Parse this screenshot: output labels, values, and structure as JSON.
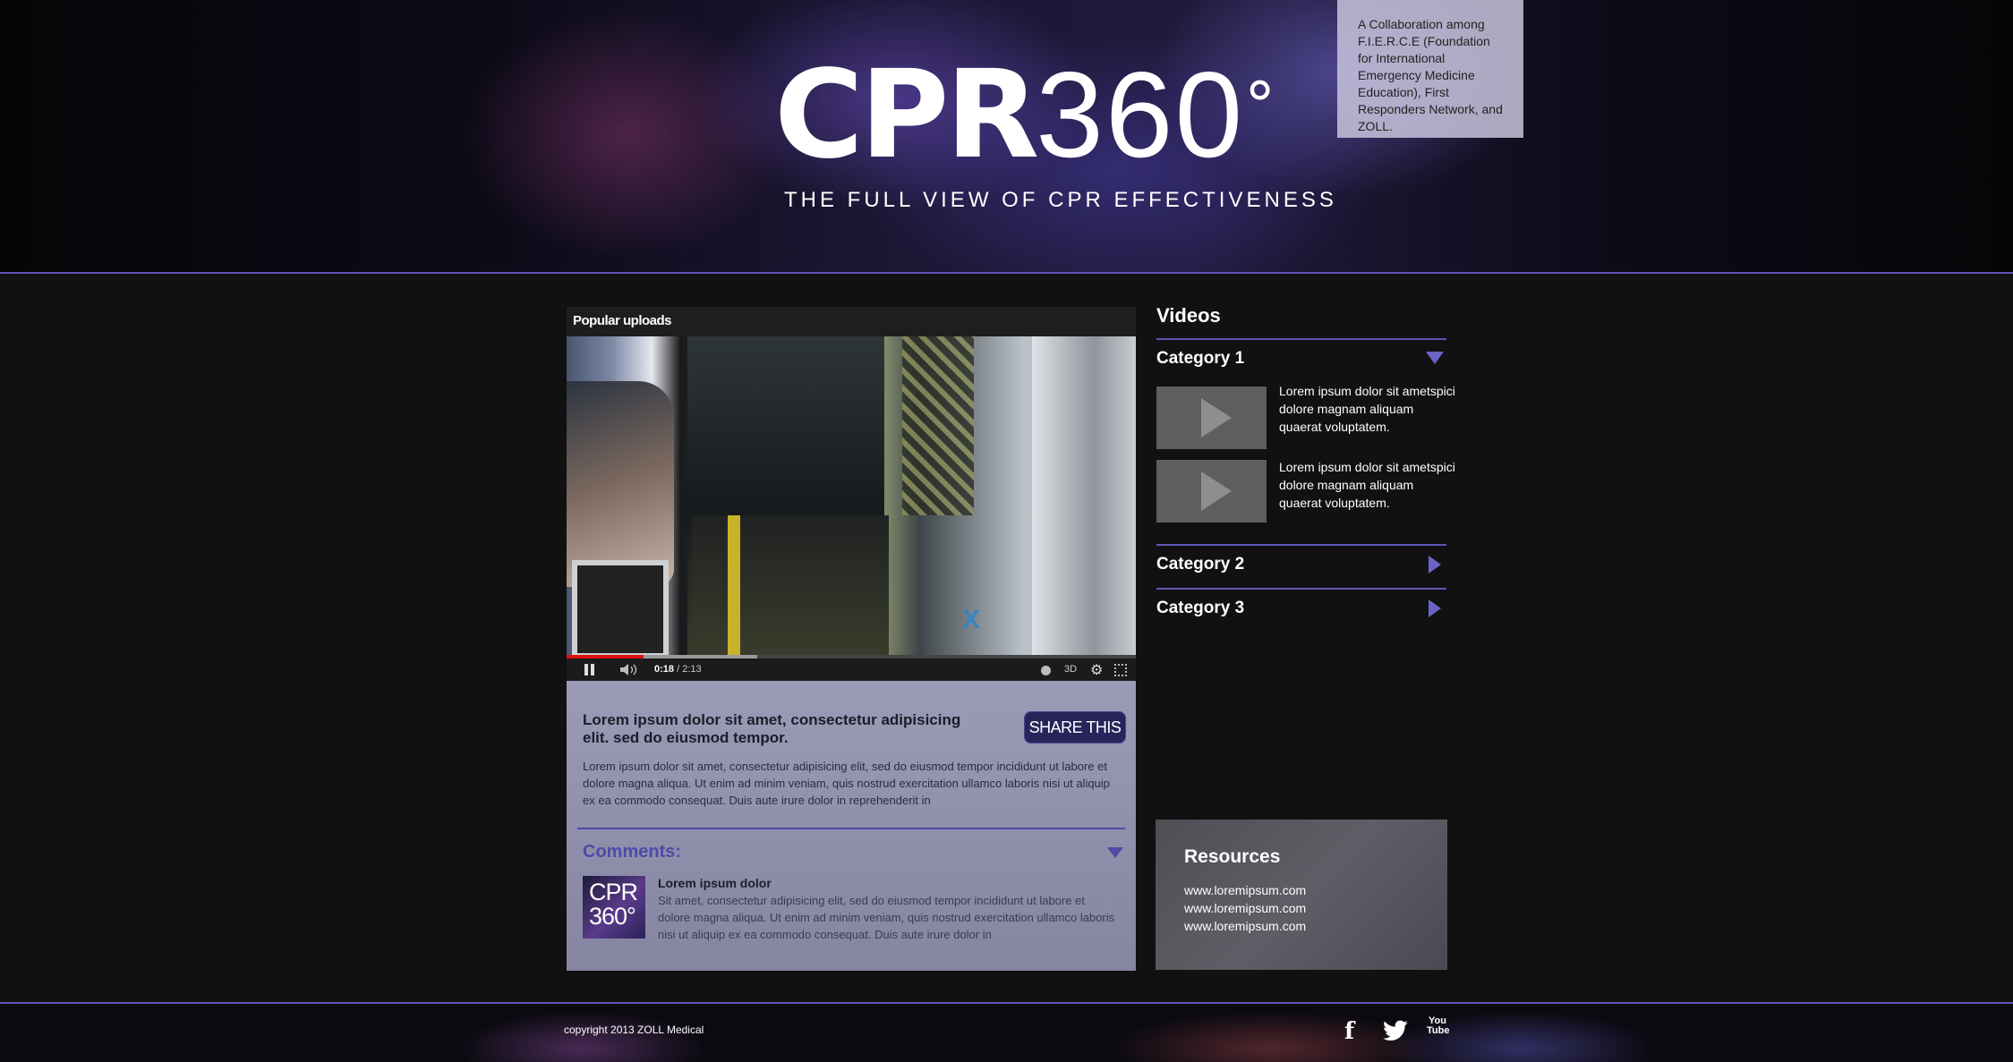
{
  "header": {
    "logo_bold": "CPR",
    "logo_light": "360",
    "logo_degree": "°",
    "tagline": "THE FULL VIEW OF CPR EFFECTIVENESS",
    "collaboration": "A Collaboration among F.I.E.R.C.E (Foundation for International Emergency Medicine Education), First Responders Network, and ZOLL."
  },
  "video_panel": {
    "heading": "Popular uploads",
    "player": {
      "current_time": "0:18",
      "duration": "2:13",
      "time_separator": " / ",
      "mode_label": "3D",
      "watermark": "X",
      "progress_played": 0.135
    },
    "title": "Lorem ipsum dolor sit amet, consectetur adipisicing elit. sed do eiusmod tempor.",
    "share_label": "SHARE THIS",
    "body": "Lorem ipsum dolor sit amet, consectetur adipisicing elit, sed do eiusmod tempor incididunt ut labore et dolore magna aliqua. Ut enim ad minim veniam, quis nostrud exercitation ullamco laboris nisi ut aliquip ex ea commodo consequat. Duis aute irure dolor in reprehenderit in",
    "comments_label": "Comments:",
    "comment": {
      "avatar_line1": "CPR",
      "avatar_line2": "360°",
      "author": "Lorem ipsum dolor",
      "text": "Sit amet, consectetur adipisicing elit, sed do eiusmod tempor incididunt ut labore et dolore magna aliqua. Ut enim ad minim veniam, quis nostrud exercitation ullamco laboris nisi ut aliquip ex ea commodo consequat. Duis aute irure dolor in"
    }
  },
  "sidebar": {
    "title": "Videos",
    "categories": [
      {
        "label": "Category 1",
        "expanded": true
      },
      {
        "label": "Category 2",
        "expanded": false
      },
      {
        "label": "Category 3",
        "expanded": false
      }
    ],
    "videos": [
      {
        "text": "Lorem ipsum dolor sit ametspici dolore magnam aliquam quaerat voluptatem."
      },
      {
        "text": "Lorem ipsum dolor sit ametspici dolore magnam aliquam quaerat voluptatem."
      }
    ],
    "resources": {
      "title": "Resources",
      "links": [
        "www.loremipsum.com",
        "www.loremipsum.com",
        "www.loremipsum.com"
      ]
    }
  },
  "footer": {
    "copyright": "copyright 2013 ZOLL Medical",
    "social": [
      {
        "icon": "facebook-icon",
        "glyph": "f"
      },
      {
        "icon": "twitter-icon",
        "glyph": "🐦"
      },
      {
        "icon": "youtube-icon",
        "glyph": "You Tube"
      }
    ]
  },
  "colors": {
    "accent": "#5d55b3",
    "share_button": "#27245a",
    "panel": "#8d8da8"
  }
}
